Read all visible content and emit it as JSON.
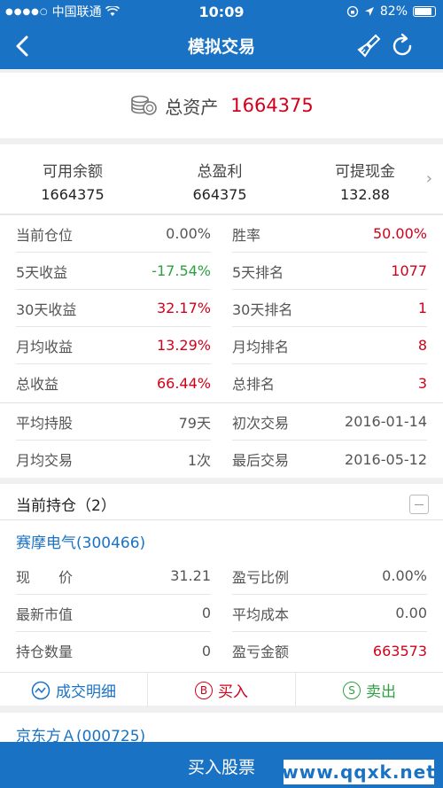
{
  "status": {
    "carrier": "中国联通",
    "time": "10:09",
    "battery": "82%"
  },
  "nav": {
    "title": "模拟交易"
  },
  "assets": {
    "label": "总资产",
    "value": "1664375"
  },
  "summary": {
    "available_label": "可用余额",
    "available_value": "1664375",
    "profit_label": "总盈利",
    "profit_value": "664375",
    "withdraw_label": "可提现金",
    "withdraw_value": "132.88"
  },
  "stats": {
    "rows": [
      {
        "l_key": "当前仓位",
        "l_val": "0.00%",
        "r_key": "胜率",
        "r_val": "50.00%"
      },
      {
        "l_key": "5天收益",
        "l_val": "-17.54%",
        "r_key": "5天排名",
        "r_val": "1077"
      },
      {
        "l_key": "30天收益",
        "l_val": "32.17%",
        "r_key": "30天排名",
        "r_val": "1"
      },
      {
        "l_key": "月均收益",
        "l_val": "13.29%",
        "r_key": "月均排名",
        "r_val": "8"
      },
      {
        "l_key": "总收益",
        "l_val": "66.44%",
        "r_key": "总排名",
        "r_val": "3"
      },
      {
        "l_key": "平均持股",
        "l_val": "79天",
        "r_key": "初次交易",
        "r_val": "2016-01-14"
      },
      {
        "l_key": "月均交易",
        "l_val": "1次",
        "r_key": "最后交易",
        "r_val": "2016-05-12"
      }
    ]
  },
  "holdings": {
    "title": "当前持仓（2）",
    "stock1": "赛摩电气(300466)",
    "rows": [
      {
        "l_key": "现　　价",
        "l_val": "31.21",
        "r_key": "盈亏比例",
        "r_val": "0.00%"
      },
      {
        "l_key": "最新市值",
        "l_val": "0",
        "r_key": "平均成本",
        "r_val": "0.00"
      },
      {
        "l_key": "持仓数量",
        "l_val": "0",
        "r_key": "盈亏金额",
        "r_val": "663573"
      }
    ],
    "actions": {
      "detail": "成交明细",
      "buy": "买入",
      "buy_icon": "B",
      "sell": "卖出",
      "sell_icon": "S"
    },
    "stock2": "京东方Ａ(000725)"
  },
  "buybar": {
    "label": "买入股票"
  },
  "watermark": "www.qqxk.net",
  "colors": {
    "brand": "#1a72c4",
    "red": "#d0021b",
    "green": "#2ea043"
  }
}
